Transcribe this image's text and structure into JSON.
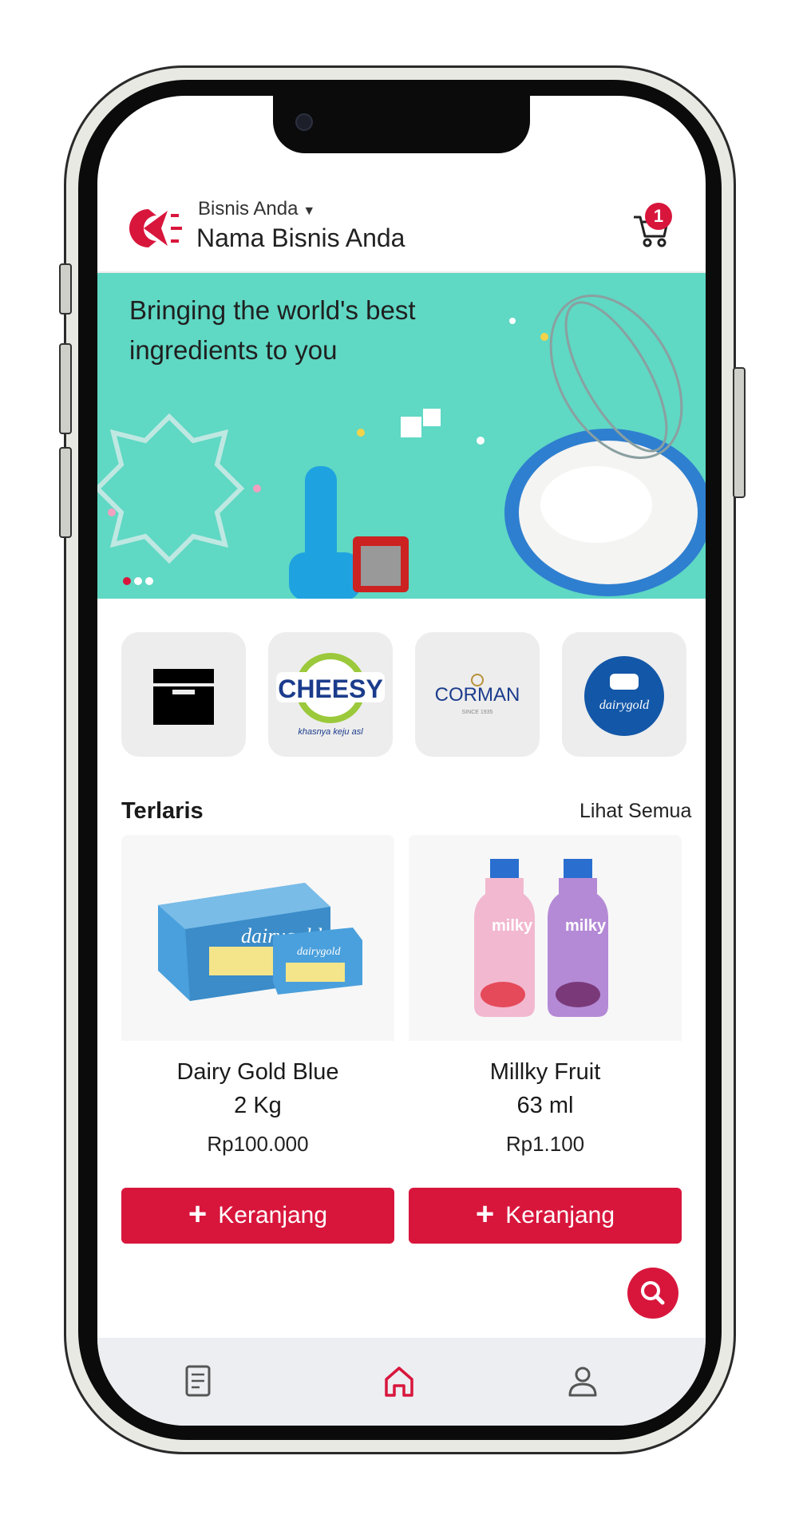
{
  "header": {
    "business_selector": "Bisnis Anda",
    "business_name": "Nama Bisnis Anda",
    "cart_count": "1"
  },
  "banner": {
    "headline": "Bringing the world's best ingredients to you",
    "slide_count": 3,
    "active_slide": 1
  },
  "brands": [
    {
      "name": "box-icon"
    },
    {
      "name": "CHEESY",
      "tagline": "khasnya keju asl"
    },
    {
      "name": "CORMAN",
      "tagline": "SINCE 1935"
    },
    {
      "name": "dairygold"
    }
  ],
  "best_sellers": {
    "title": "Terlaris",
    "see_all": "Lihat Semua",
    "products": [
      {
        "name_line1": "Dairy Gold Blue",
        "name_line2": "2 Kg",
        "price": "Rp100.000",
        "button": "Keranjang"
      },
      {
        "name_line1": "Millky Fruit",
        "name_line2": "63 ml",
        "price": "Rp1.100",
        "button": "Keranjang"
      }
    ]
  },
  "nav": {
    "items": [
      "document-icon",
      "home-icon",
      "user-icon"
    ],
    "active": "home-icon"
  },
  "colors": {
    "accent": "#d8163c",
    "banner_bg": "#5fd8c4",
    "nav_bg": "#eceef2"
  }
}
